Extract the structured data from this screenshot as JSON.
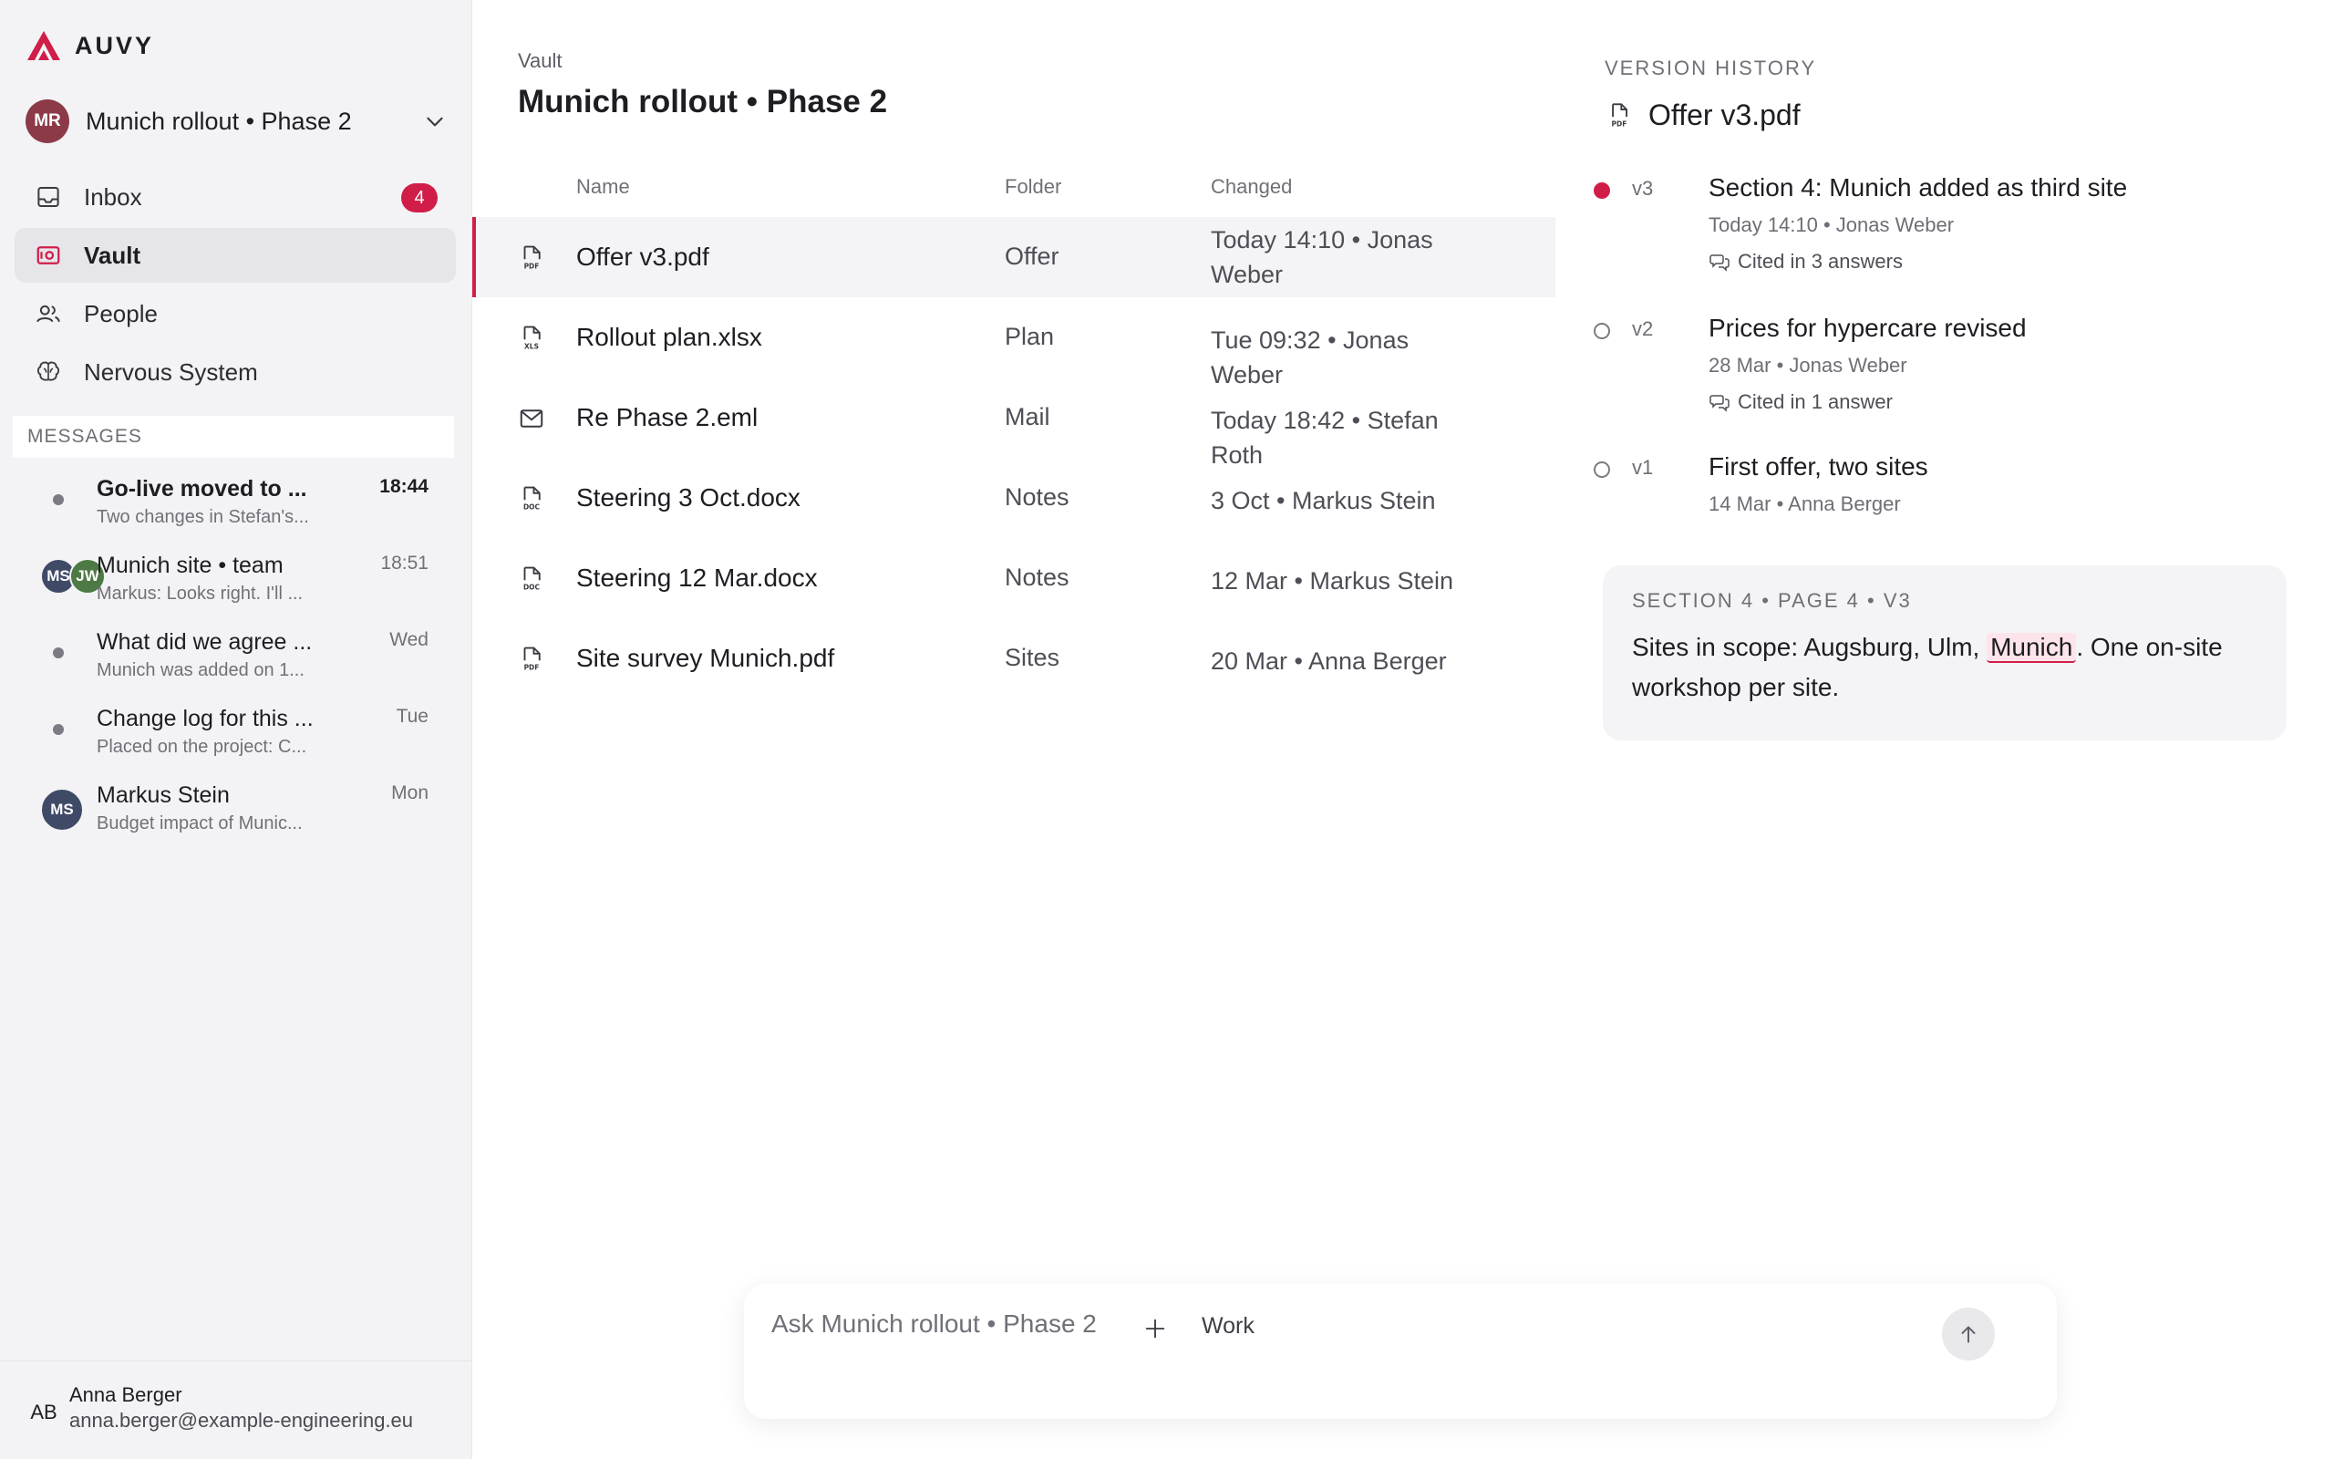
{
  "app": {
    "logo_text": "AUVY",
    "accent": "#d11e48"
  },
  "project": {
    "initials": "MR",
    "name": "Munich rollout • Phase 2",
    "avatar_color": "#8c3a48"
  },
  "nav": {
    "items": [
      {
        "label": "Inbox",
        "icon": "inbox-icon",
        "badge": "4"
      },
      {
        "label": "Vault",
        "icon": "vault-icon"
      },
      {
        "label": "People",
        "icon": "people-icon"
      },
      {
        "label": "Nervous System",
        "icon": "brain-icon"
      }
    ]
  },
  "messages": {
    "header": "MESSAGES",
    "items": [
      {
        "title": "Go-live moved to ...",
        "preview": "Two changes in Stefan's...",
        "time": "18:44",
        "unread": true
      },
      {
        "title": "Munich site • team",
        "preview": "Markus: Looks right. I'll ...",
        "time": "18:51",
        "avatars": [
          "MS",
          "JW"
        ]
      },
      {
        "title": "What did we agree ...",
        "preview": "Munich was added on 1...",
        "time": "Wed"
      },
      {
        "title": "Change log for this ...",
        "preview": "Placed on the project: C...",
        "time": "Tue"
      },
      {
        "title": "Markus Stein",
        "preview": "Budget impact of Munic...",
        "time": "Mon",
        "avatar": "MS"
      }
    ]
  },
  "user": {
    "initials": "AB",
    "name": "Anna Berger",
    "email": "anna.berger@example-engineering.eu"
  },
  "main": {
    "breadcrumb": "Vault",
    "title": "Munich rollout • Phase 2",
    "columns": [
      "Name",
      "Folder",
      "Changed"
    ],
    "files": [
      {
        "name": "Offer v3.pdf",
        "type": "PDF",
        "folder": "Offer",
        "changed": "Today 14:10 • Jonas Weber",
        "selected": true
      },
      {
        "name": "Rollout plan.xlsx",
        "type": "XLS",
        "folder": "Plan",
        "changed": "Tue 09:32 • Jonas Weber"
      },
      {
        "name": "Re Phase 2.eml",
        "type": "mail",
        "folder": "Mail",
        "changed": "Today 18:42 • Stefan Roth"
      },
      {
        "name": "Steering 3 Oct.docx",
        "type": "DOC",
        "folder": "Notes",
        "changed": "3 Oct • Markus Stein"
      },
      {
        "name": "Steering 12 Mar.docx",
        "type": "DOC",
        "folder": "Notes",
        "changed": "12 Mar • Markus Stein"
      },
      {
        "name": "Site survey Munich.pdf",
        "type": "PDF",
        "folder": "Sites",
        "changed": "20 Mar • Anna Berger"
      }
    ]
  },
  "history": {
    "label": "VERSION HISTORY",
    "file_type": "PDF",
    "file_name": "Offer v3.pdf",
    "versions": [
      {
        "tag": "v3",
        "title": "Section 4: Munich added as third site",
        "meta": "Today 14:10 • Jonas Weber",
        "cited": "Cited in 3 answers",
        "current": true
      },
      {
        "tag": "v2",
        "title": "Prices for hypercare revised",
        "meta": "28 Mar • Jonas Weber",
        "cited": "Cited in 1 answer"
      },
      {
        "tag": "v1",
        "title": "First offer, two sites",
        "meta": "14 Mar • Anna Berger"
      }
    ],
    "excerpt": {
      "label": "SECTION 4 • PAGE 4 • V3",
      "text_before": "Sites in scope: Augsburg, Ulm, ",
      "highlight": "Munich",
      "text_after": ". One on-site workshop per site."
    }
  },
  "composer": {
    "placeholder": "Ask Munich rollout • Phase 2",
    "mode": "Work"
  }
}
